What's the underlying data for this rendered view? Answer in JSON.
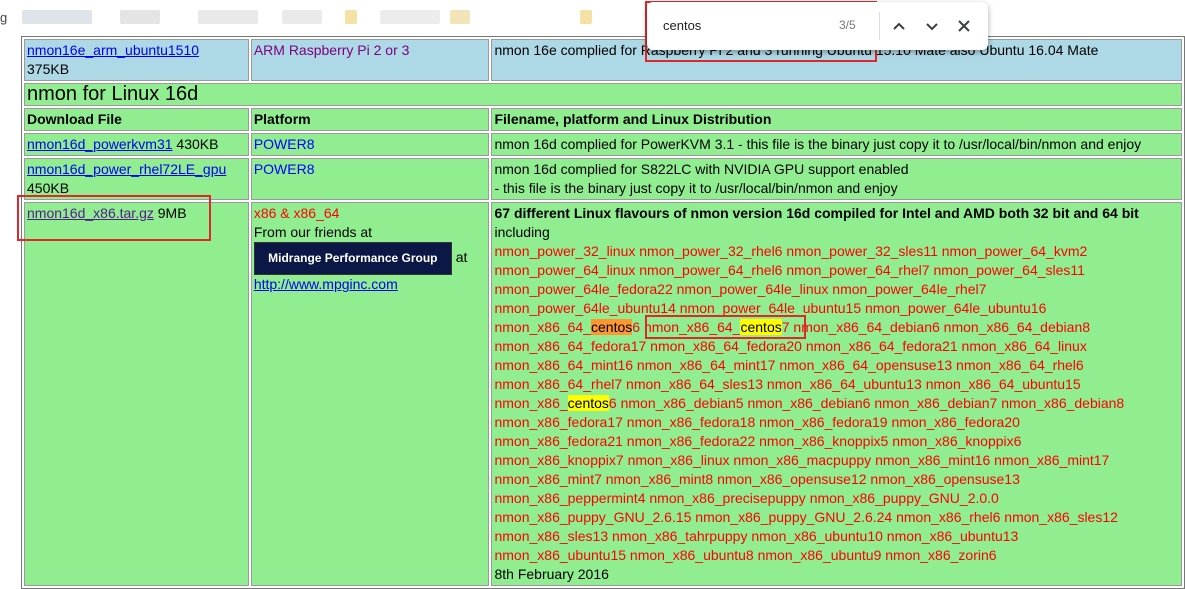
{
  "browser": {
    "left_char": "g",
    "find": {
      "query": "centos",
      "count": "3/5"
    }
  },
  "rows": {
    "arm": {
      "link": "nmon16e_arm_ubuntu1510",
      "size": "375KB",
      "platform": "ARM Raspberry Pi 2 or 3",
      "desc": "nmon 16e complied for Raspberry Pi 2 and 3 running Ubuntu 15.10 Mate also Ubuntu 16.04 Mate"
    },
    "section_title": "nmon for Linux 16d",
    "headers": [
      "Download File",
      "Platform",
      "Filename, platform and Linux Distribution"
    ],
    "powerkvm": {
      "link": "nmon16d_powerkvm31",
      "size": " 430KB",
      "platform": "POWER8",
      "desc": "nmon 16d complied for PowerKVM 3.1 - this file is the binary just copy it to /usr/local/bin/nmon and enjoy"
    },
    "gpu": {
      "link": "nmon16d_power_rhel72LE_gpu",
      "size": "450KB",
      "platform": "POWER8",
      "desc1": "nmon 16d complied for S822LC with NVIDIA GPU support enabled",
      "desc2": "- this file is the binary just copy it to /usr/local/bin/nmon and enjoy"
    },
    "x86": {
      "link": "nmon16d_x86.tar.gz",
      "size": " 9MB",
      "platform": "x86 & x86_64",
      "friends": "From our friends at",
      "logo_text": "Midrange Performance Group",
      "at": " at",
      "url": "http://www.mpginc.com",
      "title": "67 different Linux flavours of nmon version 16d compiled for Intel and AMD both 32 bit and 64 bit",
      "including": "including",
      "date": "8th February 2016",
      "lines": [
        "nmon_power_32_linux nmon_power_32_rhel6 nmon_power_32_sles11 nmon_power_64_kvm2",
        "nmon_power_64_linux nmon_power_64_rhel6 nmon_power_64_rhel7 nmon_power_64_sles11",
        "nmon_power_64le_fedora22 nmon_power_64le_linux nmon_power_64le_rhel7",
        "nmon_power_64le_ubuntu14 nmon_power_64le_ubuntu15 nmon_power_64le_ubuntu16",
        {
          "a": "nmon_x86_64_",
          "h1": "centos",
          "b": "6 ",
          "c": "nmon_x86_64_",
          "h2": "centos",
          "d": "7",
          "e": " nmon_x86_64_debian6 nmon_x86_64_debian8"
        },
        "nmon_x86_64_fedora17 nmon_x86_64_fedora20 nmon_x86_64_fedora21 nmon_x86_64_linux",
        "nmon_x86_64_mint16 nmon_x86_64_mint17 nmon_x86_64_opensuse13 nmon_x86_64_rhel6",
        "nmon_x86_64_rhel7 nmon_x86_64_sles13 nmon_x86_64_ubuntu13 nmon_x86_64_ubuntu15",
        {
          "a": "nmon_x86_",
          "h": "centos",
          "b": "6 nmon_x86_debian5 nmon_x86_debian6 nmon_x86_debian7 nmon_x86_debian8"
        },
        "nmon_x86_fedora17 nmon_x86_fedora18 nmon_x86_fedora19 nmon_x86_fedora20",
        "nmon_x86_fedora21 nmon_x86_fedora22 nmon_x86_knoppix5 nmon_x86_knoppix6",
        "nmon_x86_knoppix7 nmon_x86_linux nmon_x86_macpuppy nmon_x86_mint16 nmon_x86_mint17",
        "nmon_x86_mint7 nmon_x86_mint8 nmon_x86_opensuse12 nmon_x86_opensuse13",
        "nmon_x86_peppermint4 nmon_x86_precisepuppy nmon_x86_puppy_GNU_2.0.0",
        "nmon_x86_puppy_GNU_2.6.15 nmon_x86_puppy_GNU_2.6.24 nmon_x86_rhel6 nmon_x86_sles12",
        "nmon_x86_sles13 nmon_x86_tahrpuppy nmon_x86_ubuntu10 nmon_x86_ubuntu13",
        "nmon_x86_ubuntu15 nmon_x86_ubuntu8 nmon_x86_ubuntu9 nmon_x86_zorin6"
      ]
    }
  },
  "colors": {
    "blue_row": "#add8e6",
    "green_row": "#90ee90",
    "red_text": "#ff0000",
    "annotation_box": "#e0282c",
    "highlight": "#ffff00",
    "current_highlight": "#ff9632"
  }
}
